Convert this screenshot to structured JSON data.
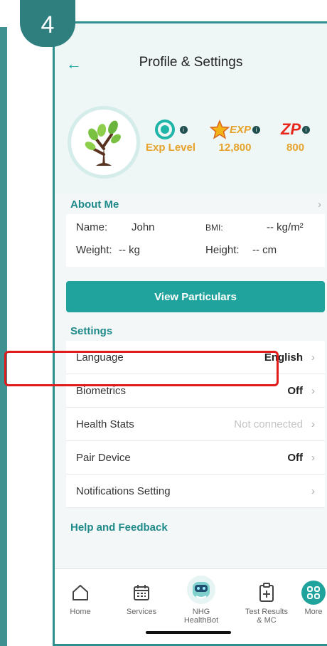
{
  "step": "4",
  "header": {
    "title": "Profile & Settings"
  },
  "stats": [
    {
      "name": "exp-level",
      "label": "Exp Level"
    },
    {
      "name": "exp",
      "label": "12,800",
      "badge": "EXP"
    },
    {
      "name": "zp",
      "label": "800",
      "badge": "ZP"
    }
  ],
  "about": {
    "heading": "About Me",
    "name_label": "Name:",
    "name_value": "John",
    "bmi_label": "BMI:",
    "bmi_value": "-- kg/m²",
    "weight_label": "Weight:",
    "weight_value": "-- kg",
    "height_label": "Height:",
    "height_value": "-- cm"
  },
  "view_button": "View Particulars",
  "settings": {
    "heading": "Settings",
    "rows": [
      {
        "label": "Language",
        "value": "English"
      },
      {
        "label": "Biometrics",
        "value": "Off"
      },
      {
        "label": "Health Stats",
        "value": "Not connected"
      },
      {
        "label": "Pair Device",
        "value": "Off"
      },
      {
        "label": "Notifications Setting",
        "value": ""
      }
    ]
  },
  "help": {
    "heading": "Help and Feedback"
  },
  "tabs": [
    {
      "label": "Home"
    },
    {
      "label": "Services"
    },
    {
      "label": "NHG HealthBot"
    },
    {
      "label": "Test Results & MC"
    },
    {
      "label": "More"
    }
  ],
  "colors": {
    "accent": "#21a39d",
    "frame": "#2f8f8f",
    "highlight": "#e11b1b",
    "gold": "#e6a22b"
  },
  "icons": [
    "back-arrow-icon",
    "tree-avatar-icon",
    "exp-level-icon",
    "star-icon",
    "zp-icon",
    "info-icon",
    "chevron-right-icon",
    "home-icon",
    "calendar-icon",
    "healthbot-icon",
    "clipboard-icon",
    "more-grid-icon"
  ]
}
